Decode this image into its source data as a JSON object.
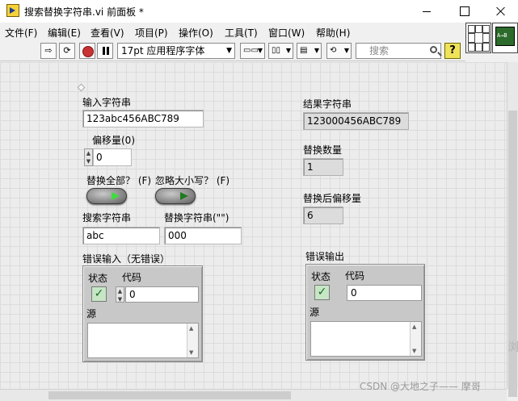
{
  "window": {
    "title": "搜索替换字符串.vi 前面板 *"
  },
  "menu": {
    "items": [
      "文件(F)",
      "编辑(E)",
      "查看(V)",
      "项目(P)",
      "操作(O)",
      "工具(T)",
      "窗口(W)",
      "帮助(H)"
    ]
  },
  "toolbar": {
    "font_label": "17pt 应用程序字体",
    "search_placeholder": "搜索",
    "help_label": "?"
  },
  "controls": {
    "input_string": {
      "label": "输入字符串",
      "value": "123abc456ABC789"
    },
    "offset": {
      "label": "偏移量(0)",
      "value": "0"
    },
    "replace_all": {
      "label": "替换全部？ (F)",
      "state": true
    },
    "ignore_case": {
      "label": "忽略大小写？ (F)",
      "state": false
    },
    "search_string": {
      "label": "搜索字符串",
      "value": "abc"
    },
    "replace_string": {
      "label": "替换字符串(\"\")",
      "value": "000"
    },
    "error_in": {
      "label": "错误输入（无错误）",
      "status_label": "状态",
      "code_label": "代码",
      "code_value": "0",
      "source_label": "源"
    }
  },
  "indicators": {
    "result_string": {
      "label": "结果字符串",
      "value": "123000456ABC789"
    },
    "replace_count": {
      "label": "替换数量",
      "value": "1"
    },
    "offset_after": {
      "label": "替换后偏移量",
      "value": "6"
    },
    "error_out": {
      "label": "错误输出",
      "status_label": "状态",
      "code_label": "代码",
      "code_value": "0",
      "source_label": "源"
    }
  },
  "watermark": {
    "text": "CSDN @大地之子—— 摩哥",
    "side_char": "浏"
  }
}
